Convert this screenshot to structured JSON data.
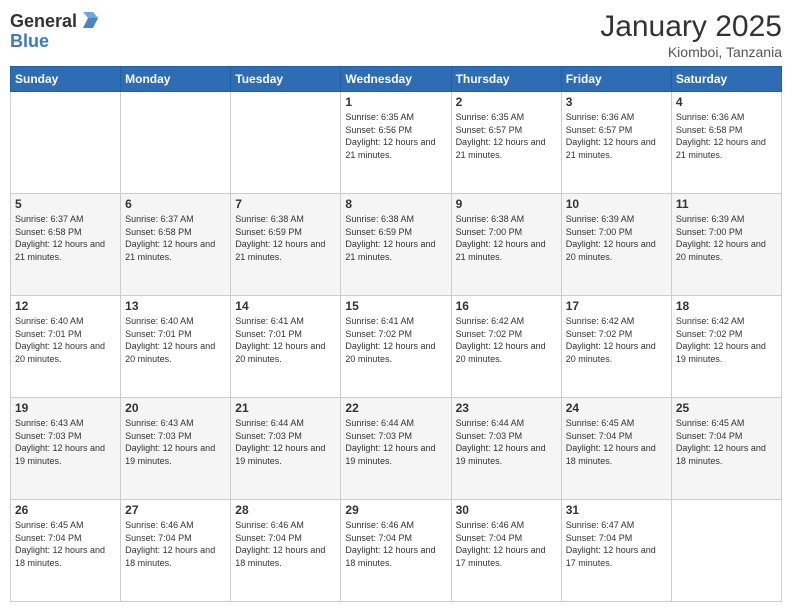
{
  "header": {
    "logo_general": "General",
    "logo_blue": "Blue",
    "month_title": "January 2025",
    "location": "Kiomboi, Tanzania"
  },
  "weekdays": [
    "Sunday",
    "Monday",
    "Tuesday",
    "Wednesday",
    "Thursday",
    "Friday",
    "Saturday"
  ],
  "weeks": [
    [
      {
        "day": "",
        "info": ""
      },
      {
        "day": "",
        "info": ""
      },
      {
        "day": "",
        "info": ""
      },
      {
        "day": "1",
        "info": "Sunrise: 6:35 AM\nSunset: 6:56 PM\nDaylight: 12 hours and 21 minutes."
      },
      {
        "day": "2",
        "info": "Sunrise: 6:35 AM\nSunset: 6:57 PM\nDaylight: 12 hours and 21 minutes."
      },
      {
        "day": "3",
        "info": "Sunrise: 6:36 AM\nSunset: 6:57 PM\nDaylight: 12 hours and 21 minutes."
      },
      {
        "day": "4",
        "info": "Sunrise: 6:36 AM\nSunset: 6:58 PM\nDaylight: 12 hours and 21 minutes."
      }
    ],
    [
      {
        "day": "5",
        "info": "Sunrise: 6:37 AM\nSunset: 6:58 PM\nDaylight: 12 hours and 21 minutes."
      },
      {
        "day": "6",
        "info": "Sunrise: 6:37 AM\nSunset: 6:58 PM\nDaylight: 12 hours and 21 minutes."
      },
      {
        "day": "7",
        "info": "Sunrise: 6:38 AM\nSunset: 6:59 PM\nDaylight: 12 hours and 21 minutes."
      },
      {
        "day": "8",
        "info": "Sunrise: 6:38 AM\nSunset: 6:59 PM\nDaylight: 12 hours and 21 minutes."
      },
      {
        "day": "9",
        "info": "Sunrise: 6:38 AM\nSunset: 7:00 PM\nDaylight: 12 hours and 21 minutes."
      },
      {
        "day": "10",
        "info": "Sunrise: 6:39 AM\nSunset: 7:00 PM\nDaylight: 12 hours and 20 minutes."
      },
      {
        "day": "11",
        "info": "Sunrise: 6:39 AM\nSunset: 7:00 PM\nDaylight: 12 hours and 20 minutes."
      }
    ],
    [
      {
        "day": "12",
        "info": "Sunrise: 6:40 AM\nSunset: 7:01 PM\nDaylight: 12 hours and 20 minutes."
      },
      {
        "day": "13",
        "info": "Sunrise: 6:40 AM\nSunset: 7:01 PM\nDaylight: 12 hours and 20 minutes."
      },
      {
        "day": "14",
        "info": "Sunrise: 6:41 AM\nSunset: 7:01 PM\nDaylight: 12 hours and 20 minutes."
      },
      {
        "day": "15",
        "info": "Sunrise: 6:41 AM\nSunset: 7:02 PM\nDaylight: 12 hours and 20 minutes."
      },
      {
        "day": "16",
        "info": "Sunrise: 6:42 AM\nSunset: 7:02 PM\nDaylight: 12 hours and 20 minutes."
      },
      {
        "day": "17",
        "info": "Sunrise: 6:42 AM\nSunset: 7:02 PM\nDaylight: 12 hours and 20 minutes."
      },
      {
        "day": "18",
        "info": "Sunrise: 6:42 AM\nSunset: 7:02 PM\nDaylight: 12 hours and 19 minutes."
      }
    ],
    [
      {
        "day": "19",
        "info": "Sunrise: 6:43 AM\nSunset: 7:03 PM\nDaylight: 12 hours and 19 minutes."
      },
      {
        "day": "20",
        "info": "Sunrise: 6:43 AM\nSunset: 7:03 PM\nDaylight: 12 hours and 19 minutes."
      },
      {
        "day": "21",
        "info": "Sunrise: 6:44 AM\nSunset: 7:03 PM\nDaylight: 12 hours and 19 minutes."
      },
      {
        "day": "22",
        "info": "Sunrise: 6:44 AM\nSunset: 7:03 PM\nDaylight: 12 hours and 19 minutes."
      },
      {
        "day": "23",
        "info": "Sunrise: 6:44 AM\nSunset: 7:03 PM\nDaylight: 12 hours and 19 minutes."
      },
      {
        "day": "24",
        "info": "Sunrise: 6:45 AM\nSunset: 7:04 PM\nDaylight: 12 hours and 18 minutes."
      },
      {
        "day": "25",
        "info": "Sunrise: 6:45 AM\nSunset: 7:04 PM\nDaylight: 12 hours and 18 minutes."
      }
    ],
    [
      {
        "day": "26",
        "info": "Sunrise: 6:45 AM\nSunset: 7:04 PM\nDaylight: 12 hours and 18 minutes."
      },
      {
        "day": "27",
        "info": "Sunrise: 6:46 AM\nSunset: 7:04 PM\nDaylight: 12 hours and 18 minutes."
      },
      {
        "day": "28",
        "info": "Sunrise: 6:46 AM\nSunset: 7:04 PM\nDaylight: 12 hours and 18 minutes."
      },
      {
        "day": "29",
        "info": "Sunrise: 6:46 AM\nSunset: 7:04 PM\nDaylight: 12 hours and 18 minutes."
      },
      {
        "day": "30",
        "info": "Sunrise: 6:46 AM\nSunset: 7:04 PM\nDaylight: 12 hours and 17 minutes."
      },
      {
        "day": "31",
        "info": "Sunrise: 6:47 AM\nSunset: 7:04 PM\nDaylight: 12 hours and 17 minutes."
      },
      {
        "day": "",
        "info": ""
      }
    ]
  ]
}
